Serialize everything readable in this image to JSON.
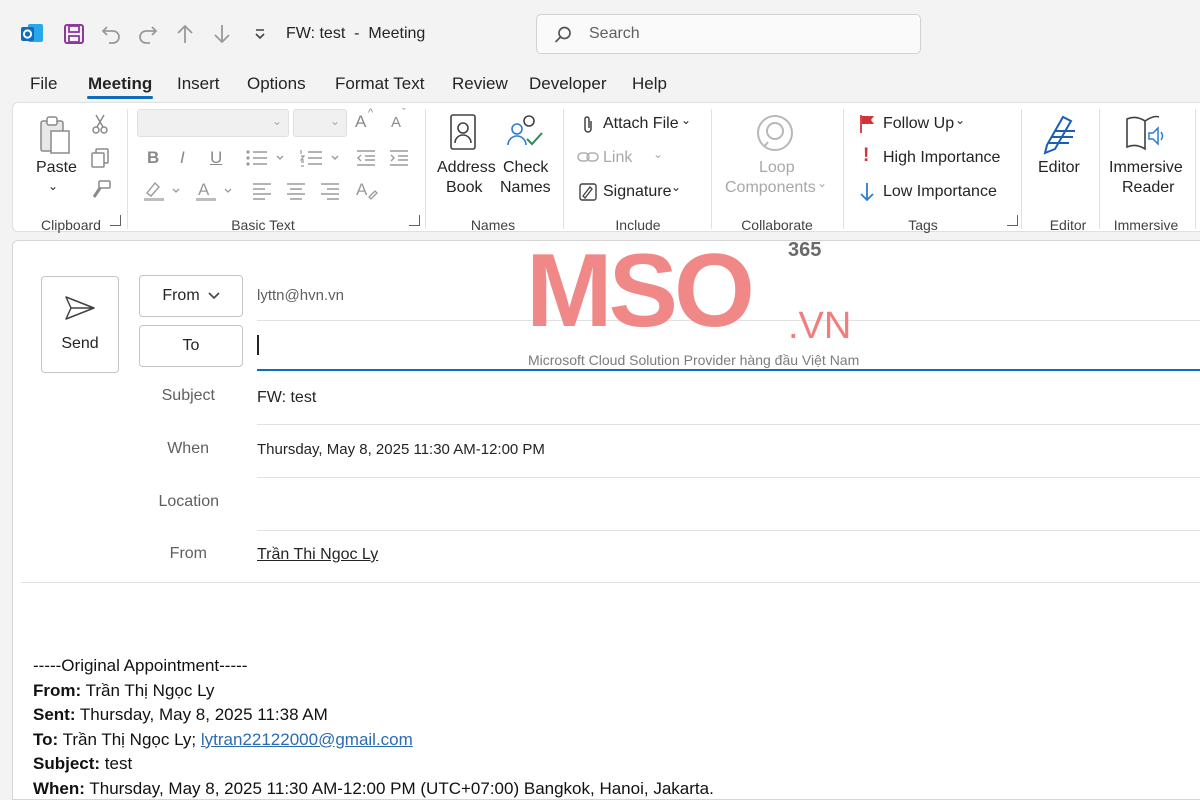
{
  "window": {
    "title": "FW: test  -  Meeting"
  },
  "search": {
    "placeholder": "Search"
  },
  "tabs": [
    "File",
    "Meeting",
    "Insert",
    "Options",
    "Format Text",
    "Review",
    "Developer",
    "Help"
  ],
  "ribbon": {
    "clipboard": {
      "paste": "Paste",
      "group": "Clipboard"
    },
    "basic_text": {
      "group": "Basic Text",
      "bold": "B",
      "italic": "I",
      "underline": "U",
      "grow": "A",
      "shrink": "A"
    },
    "names": {
      "address": [
        "Address",
        "Book"
      ],
      "check": [
        "Check",
        "Names"
      ],
      "group": "Names"
    },
    "include": {
      "attach": "Attach File",
      "link": "Link",
      "signature": "Signature",
      "group": "Include"
    },
    "collaborate": {
      "loop": [
        "Loop",
        "Components"
      ],
      "group": "Collaborate"
    },
    "tags": {
      "follow": "Follow Up",
      "high": "High Importance",
      "low": "Low Importance",
      "group": "Tags"
    },
    "editor": {
      "label": "Editor",
      "group": "Editor"
    },
    "immersive": {
      "label": [
        "Immersive",
        "Reader"
      ],
      "group": "Immersive"
    }
  },
  "compose": {
    "send": "Send",
    "from_btn": "From",
    "from_value": "lyttn@hvn.vn",
    "to_btn": "To",
    "labels": {
      "subject": "Subject",
      "when": "When",
      "location": "Location",
      "organizer": "From"
    },
    "subject": "FW: test",
    "when": "Thursday, May 8, 2025 11:30 AM-12:00 PM",
    "location": "",
    "organizer": "Trần Thi Ngoc Ly"
  },
  "body": {
    "header": "-----Original Appointment-----",
    "from_label": "From:",
    "from": " Trần Thị Ngọc Ly",
    "sent_label": "Sent:",
    "sent": " Thursday, May 8, 2025 11:38 AM",
    "to_label": "To:",
    "to": " Trần Thị Ngọc Ly; ",
    "to_email": "lytran22122000@gmail.com",
    "subject_label": "Subject:",
    "subject": " test",
    "when_label": "When:",
    "when": " Thursday, May 8, 2025 11:30 AM-12:00 PM (UTC+07:00) Bangkok, Hanoi, Jakarta."
  },
  "watermark": {
    "brand": "MSO",
    "sup": "365",
    "tld": ".VN",
    "tagline": "Microsoft Cloud Solution Provider hàng đầu Việt Nam"
  },
  "colors": {
    "accent": "#0f6cbd",
    "watermark": "#f07e7e",
    "flag": "#d13438"
  }
}
